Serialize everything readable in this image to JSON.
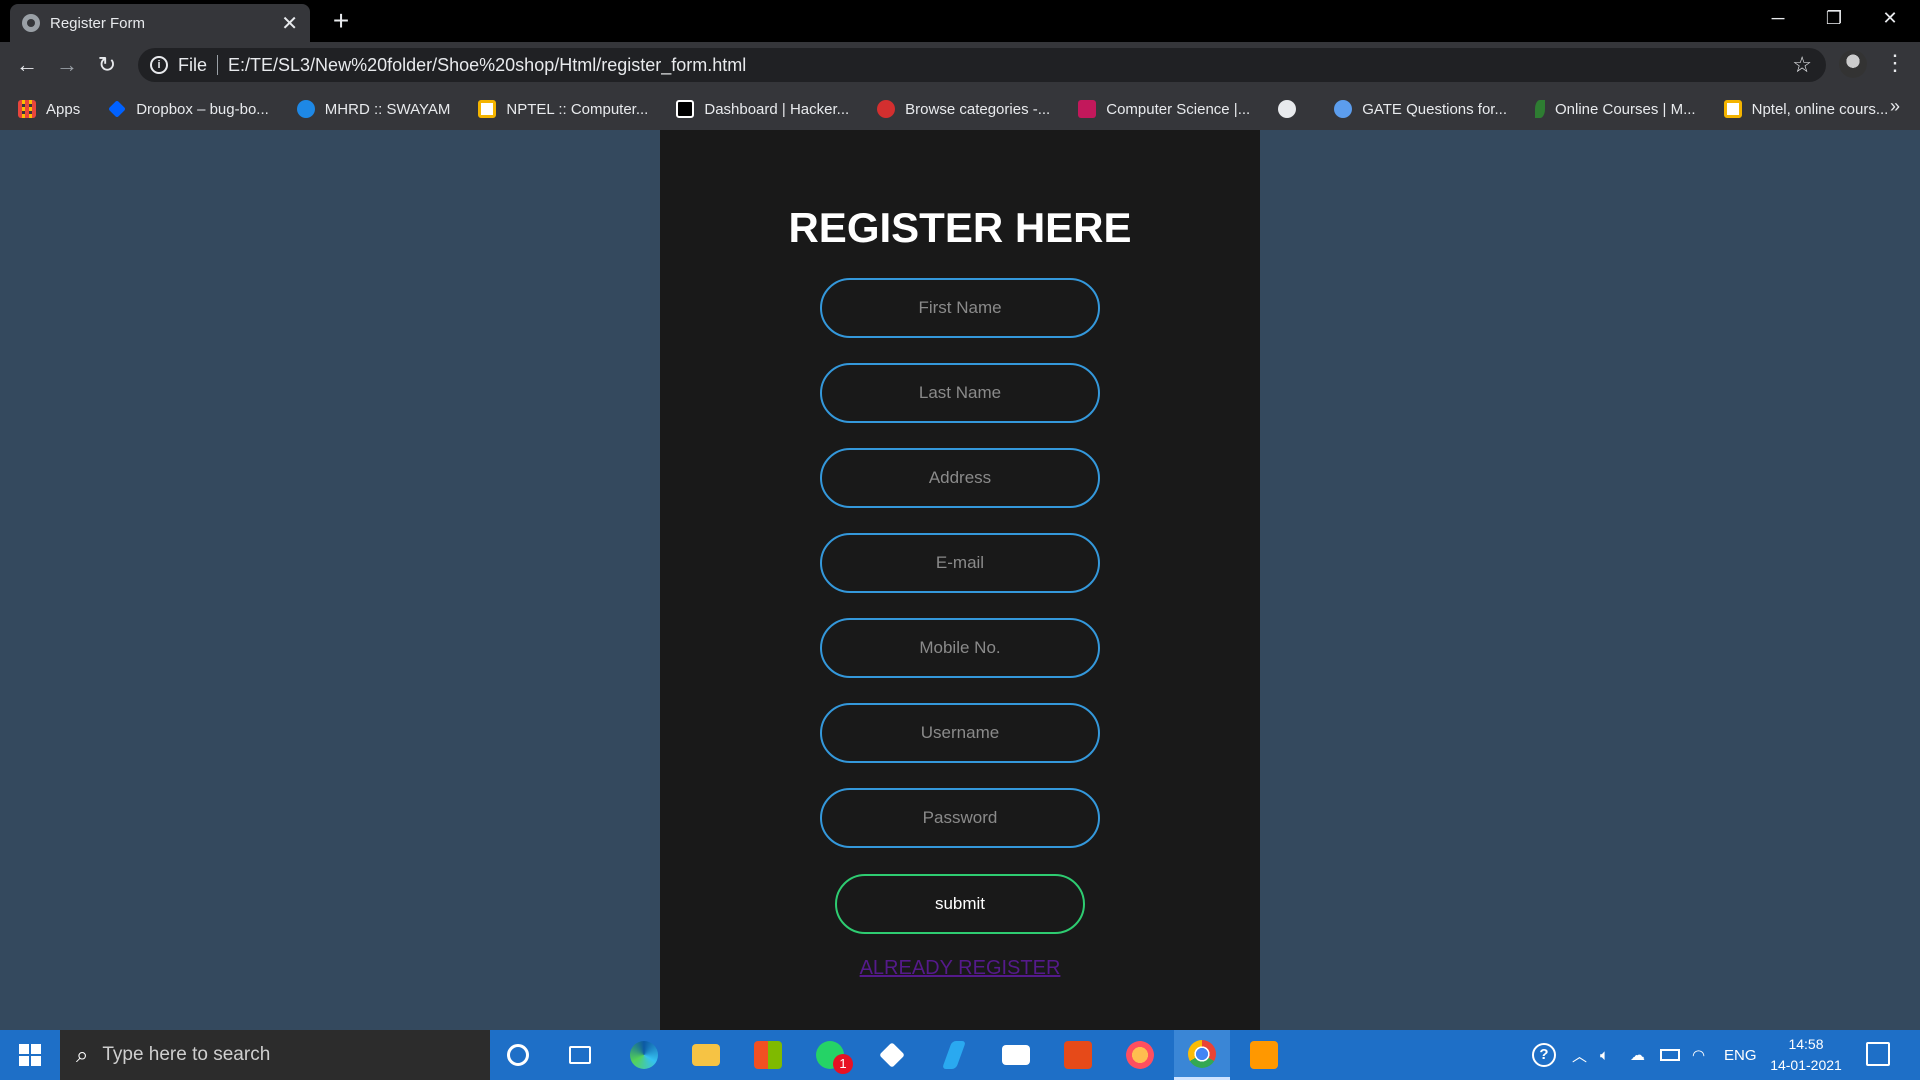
{
  "browser": {
    "tab_title": "Register Form",
    "tab_close": "✕",
    "new_tab": "+",
    "window_controls": {
      "minimize": "─",
      "restore": "❐",
      "close": "✕"
    },
    "nav": {
      "back": "←",
      "forward": "→",
      "reload": "↻"
    },
    "address_scheme": "File",
    "address_url": "E:/TE/SL3/New%20folder/Shoe%20shop/Html/register_form.html",
    "bookmarks": [
      {
        "label": "Apps",
        "icon": "apps-grid-icon",
        "color": "#e8453c"
      },
      {
        "label": "Dropbox – bug-bo...",
        "icon": "dropbox-icon",
        "color": "#0061ff"
      },
      {
        "label": "MHRD :: SWAYAM",
        "icon": "swayam-icon",
        "color": "#1e88e5"
      },
      {
        "label": "NPTEL :: Computer...",
        "icon": "nptel-icon",
        "color": "#f4b400"
      },
      {
        "label": "Dashboard | Hacker...",
        "icon": "hackerrank-icon",
        "color": "#ffffff"
      },
      {
        "label": "Browse categories -...",
        "icon": "category-icon",
        "color": "#d32f2f"
      },
      {
        "label": "Computer Science |...",
        "icon": "g-icon",
        "color": "#c2185b"
      },
      {
        "label": "",
        "icon": "globe-icon",
        "color": "#e8eaed"
      },
      {
        "label": "GATE Questions for...",
        "icon": "gate-icon",
        "color": "#5c9ded"
      },
      {
        "label": "Online Courses | M...",
        "icon": "leaf-icon",
        "color": "#2e7d32"
      },
      {
        "label": "Nptel, online cours...",
        "icon": "nptel-icon",
        "color": "#f4b400"
      }
    ],
    "bookmarks_more": "»"
  },
  "page": {
    "heading": "REGISTER HERE",
    "fields": {
      "first_name": "First Name",
      "last_name": "Last Name",
      "address": "Address",
      "email": "E-mail",
      "mobile": "Mobile No.",
      "username": "Username",
      "password": "Password"
    },
    "submit_label": "submit",
    "login_link": "ALREADY REGISTER",
    "colors": {
      "field_border": "#3498db",
      "submit_border": "#2ecc71",
      "background": "#34495e",
      "card": "#191919"
    }
  },
  "taskbar": {
    "search_placeholder": "Type here to search",
    "language": "ENG",
    "time": "14:58",
    "date": "14-01-2021",
    "whatsapp_badge": "1"
  }
}
